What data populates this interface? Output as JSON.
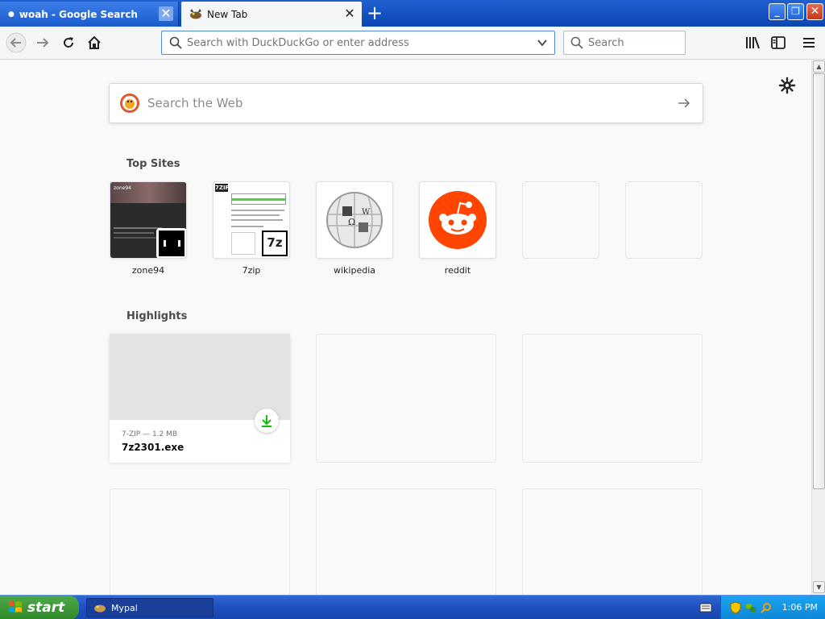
{
  "tabs": [
    {
      "title": "woah - Google Search",
      "active": false
    },
    {
      "title": "New Tab",
      "active": true
    }
  ],
  "toolbar": {
    "url_placeholder": "Search with DuckDuckGo or enter address",
    "search_placeholder": "Search"
  },
  "newtab": {
    "web_search_placeholder": "Search the Web",
    "top_sites_title": "Top Sites",
    "top_sites": [
      {
        "label": "zone94",
        "icon": "zone94-thumbnail"
      },
      {
        "label": "7zip",
        "icon": "7zip-thumbnail"
      },
      {
        "label": "wikipedia",
        "icon": "wikipedia-globe-icon"
      },
      {
        "label": "reddit",
        "icon": "reddit-alien-icon"
      },
      {
        "label": "",
        "icon": ""
      },
      {
        "label": "",
        "icon": ""
      }
    ],
    "highlights_title": "Highlights",
    "highlights": [
      {
        "meta": "7-ZIP — 1.2 MB",
        "filename": "7z2301.exe",
        "icon": "download-icon"
      }
    ]
  },
  "taskbar": {
    "start_label": "start",
    "task_item": "Mypal",
    "clock": "1:06 PM"
  },
  "colors": {
    "accent_blue": "#4f8be0",
    "reddit_orange": "#ff4500",
    "download_green": "#12bc00",
    "xp_taskbar": "#245edb",
    "xp_start_green": "#3c9a35"
  }
}
